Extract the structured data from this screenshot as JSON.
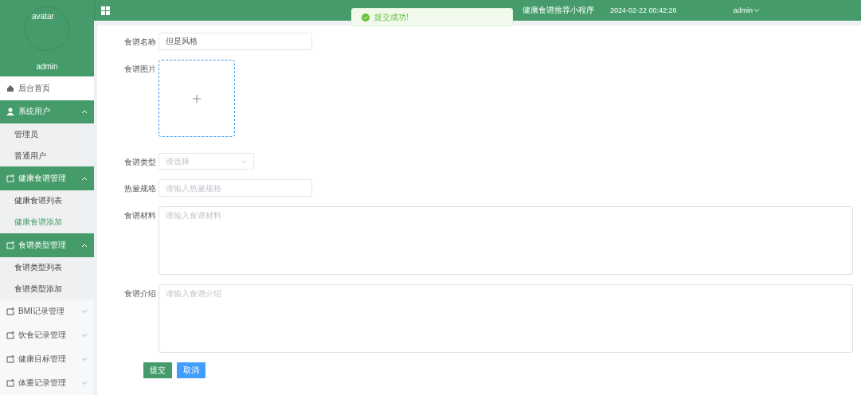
{
  "sidebar": {
    "avatar_alt": "avatar",
    "username": "admin",
    "menu": [
      {
        "kind": "link",
        "label": "后台首页",
        "selected": false
      },
      {
        "kind": "user-group",
        "label": "系统用户",
        "expanded": true,
        "children": [
          {
            "label": "管理员",
            "selected": false
          },
          {
            "label": "普通用户",
            "selected": false
          }
        ]
      },
      {
        "kind": "group",
        "label": "健康食谱管理",
        "expanded": true,
        "children": [
          {
            "label": "健康食谱列表",
            "selected": false
          },
          {
            "label": "健康食谱添加",
            "selected": true
          }
        ]
      },
      {
        "kind": "group",
        "label": "食谱类型管理",
        "expanded": true,
        "children": [
          {
            "label": "食谱类型列表",
            "selected": false
          },
          {
            "label": "食谱类型添加",
            "selected": false
          }
        ]
      },
      {
        "kind": "group",
        "label": "BMI记录管理",
        "expanded": false
      },
      {
        "kind": "group",
        "label": "饮食记录管理",
        "expanded": false
      },
      {
        "kind": "group",
        "label": "健康目标管理",
        "expanded": false
      },
      {
        "kind": "group",
        "label": "体重记录管理",
        "expanded": false
      }
    ]
  },
  "header": {
    "title": "健康食谱推荐小程序",
    "datetime": "2024-02-22 00:42:26",
    "user": "admin"
  },
  "toast": {
    "message": "提交成功!"
  },
  "form": {
    "fields": [
      {
        "kind": "input",
        "label": "食谱名称",
        "value": "但是风格"
      },
      {
        "kind": "upload",
        "label": "食谱图片"
      },
      {
        "kind": "select",
        "label": "食谱类型",
        "placeholder": "请选择"
      },
      {
        "kind": "input",
        "label": "热量规格",
        "placeholder": "请输入热量规格"
      },
      {
        "kind": "textarea",
        "label": "食谱材料",
        "placeholder": "请输入食谱材料"
      },
      {
        "kind": "textarea",
        "label": "食谱介绍",
        "placeholder": "请输入食谱介绍"
      }
    ],
    "buttons": [
      {
        "kind": "primary",
        "label": "提交"
      },
      {
        "kind": "secondary",
        "label": "取消"
      }
    ]
  }
}
